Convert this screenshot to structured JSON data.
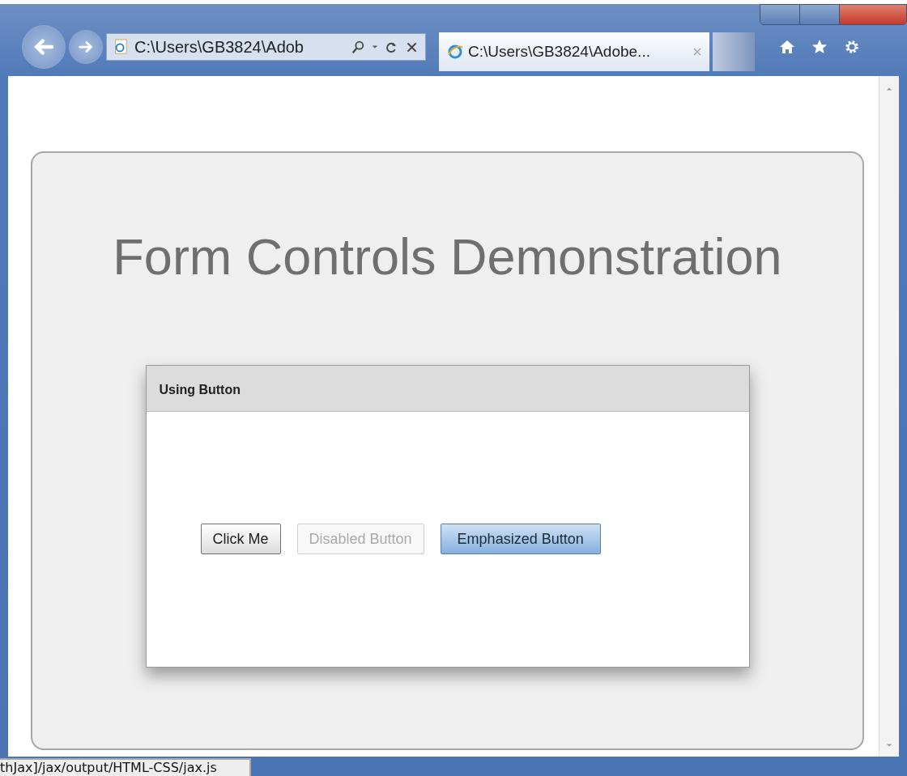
{
  "browser": {
    "address": "C:\\Users\\GB3824\\Adob",
    "tabs": [
      {
        "title": "C:\\Users\\GB3824\\Adobe...",
        "selected": true
      }
    ]
  },
  "page": {
    "title": "Form Controls Demonstration",
    "panel": {
      "title": "Using Button",
      "buttons": [
        {
          "label": "Click Me",
          "kind": "normal"
        },
        {
          "label": "Disabled Button",
          "kind": "disabled"
        },
        {
          "label": "Emphasized Button",
          "kind": "emphasized"
        }
      ]
    }
  },
  "status_bar": {
    "text": "thJax]/jax/output/HTML-CSS/jax.js"
  }
}
